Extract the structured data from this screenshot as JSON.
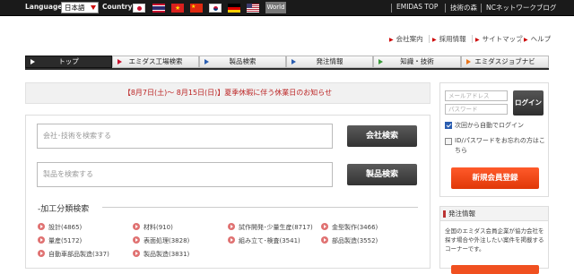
{
  "topbar": {
    "language_label": "Language:",
    "language_value": "日本語",
    "country_label": "Country:",
    "world_label": "World",
    "links": [
      "EMIDAS TOP",
      "技術の森",
      "NCネットワークブログ"
    ],
    "flags": [
      "japan-flag-icon",
      "thailand-flag-icon",
      "vietnam-flag-icon",
      "china-flag-icon",
      "korea-flag-icon",
      "germany-flag-icon",
      "usa-flag-icon"
    ]
  },
  "sublinks": [
    "会社案内",
    "採用情報",
    "サイトマップ",
    "ヘルプ"
  ],
  "nav": {
    "tabs": [
      {
        "label": "トップ",
        "color": "#ffffff"
      },
      {
        "label": "エミダス工場検索",
        "color": "#c8102e"
      },
      {
        "label": "製品検索",
        "color": "#2a5db0"
      },
      {
        "label": "発注情報",
        "color": "#2a5db0"
      },
      {
        "label": "知識・技術",
        "color": "#3a9a3a"
      },
      {
        "label": "エミダスジョブナビ",
        "color": "#e8741a"
      }
    ]
  },
  "notice": "【8月7日(土)〜 8月15日(日)】夏季休暇に伴う休業日のお知らせ",
  "search": {
    "company_placeholder": "会社･技術を検索する",
    "company_button": "会社検索",
    "product_placeholder": "製品を検索する",
    "product_button": "製品検索"
  },
  "process": {
    "title": "-加工分類検索",
    "categories": [
      "設計(4865)",
      "材料(910)",
      "試作開発･少量生産(8717)",
      "金型製作(3466)",
      "量産(5172)",
      "表面処理(3828)",
      "組み立て･検査(3541)",
      "部品製造(3552)",
      "自動車部品製造(337)",
      "製品製造(3831)"
    ]
  },
  "login": {
    "email_placeholder": "メールアドレス",
    "password_placeholder": "パスワード",
    "login_button": "ログイン",
    "auto_login": "次回から自動でログイン",
    "forgot": "ID/パスワードをお忘れの方はこちら",
    "register": "新規会員登録"
  },
  "order": {
    "title": "発注情報",
    "text": "全国のエミダス会員企業が協力会社を探す場合や外注したい案件を掲載するコーナーです。"
  }
}
